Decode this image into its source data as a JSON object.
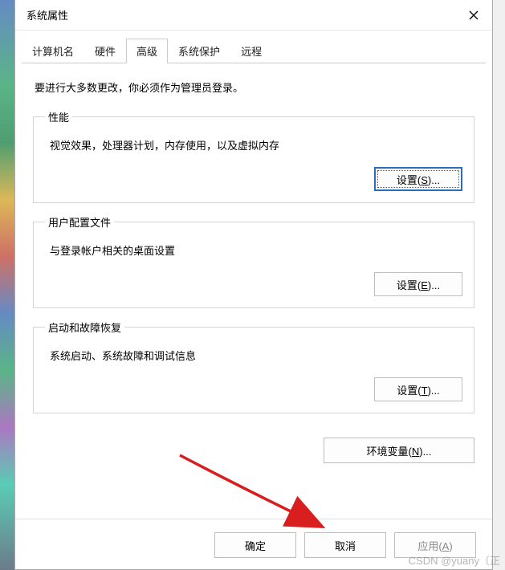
{
  "dialog": {
    "title": "系统属性",
    "close_label": "✕"
  },
  "tabs": [
    {
      "label": "计算机名"
    },
    {
      "label": "硬件"
    },
    {
      "label": "高级",
      "active": true
    },
    {
      "label": "系统保护"
    },
    {
      "label": "远程"
    }
  ],
  "intro": "要进行大多数更改，你必须作为管理员登录。",
  "sections": {
    "performance": {
      "legend": "性能",
      "desc": "视觉效果，处理器计划，内存使用，以及虚拟内存",
      "button": "设置(S)..."
    },
    "profiles": {
      "legend": "用户配置文件",
      "desc": "与登录帐户相关的桌面设置",
      "button": "设置(E)..."
    },
    "startup": {
      "legend": "启动和故障恢复",
      "desc": "系统启动、系统故障和调试信息",
      "button": "设置(T)..."
    }
  },
  "env_button": "环境变量(N)...",
  "footer": {
    "ok": "确定",
    "cancel": "取消",
    "apply": "应用(A)"
  },
  "watermark": "CSDN @yuany〔正"
}
